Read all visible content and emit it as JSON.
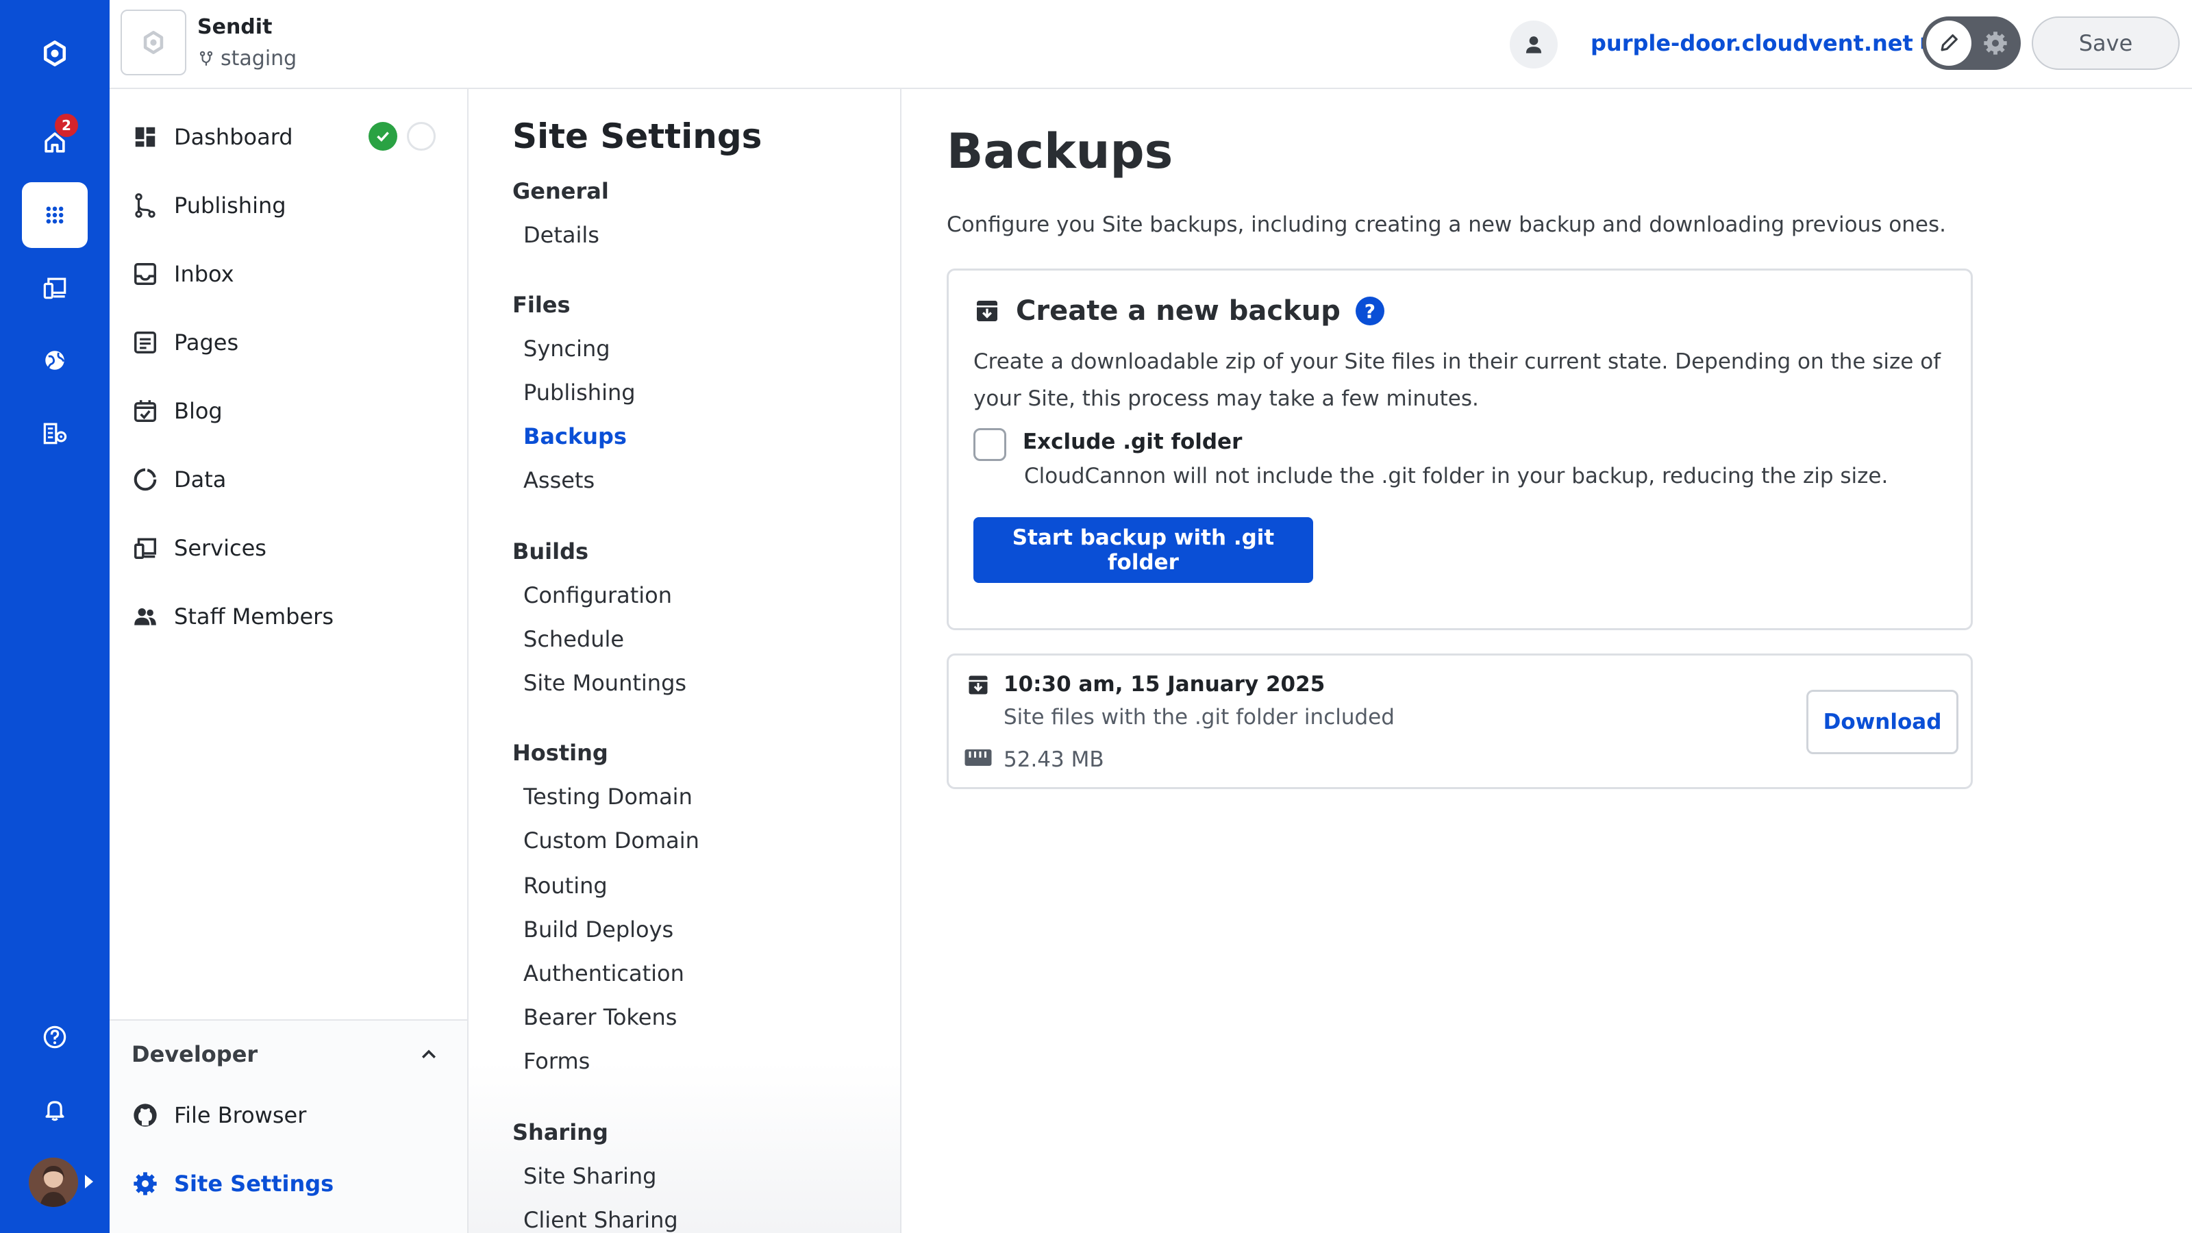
{
  "site": {
    "name": "Sendit",
    "branch": "staging",
    "domain": "purple-door.cloudvent.net"
  },
  "toolbar": {
    "save_label": "Save"
  },
  "rail": {
    "home_badge": "2"
  },
  "nav": {
    "items": [
      {
        "label": "Dashboard",
        "icon": "dashboard-icon"
      },
      {
        "label": "Publishing",
        "icon": "branch-icon"
      },
      {
        "label": "Inbox",
        "icon": "inbox-icon"
      },
      {
        "label": "Pages",
        "icon": "pages-icon"
      },
      {
        "label": "Blog",
        "icon": "calendar-check-icon"
      },
      {
        "label": "Data",
        "icon": "data-icon"
      },
      {
        "label": "Services",
        "icon": "services-icon"
      },
      {
        "label": "Staff Members",
        "icon": "people-icon"
      }
    ],
    "developer": {
      "heading": "Developer",
      "items": [
        {
          "label": "File Browser",
          "icon": "github-icon"
        },
        {
          "label": "Site Settings",
          "icon": "gear-icon"
        }
      ]
    }
  },
  "settings_nav": {
    "title": "Site Settings",
    "groups": [
      {
        "label": "General",
        "items": [
          "Details"
        ]
      },
      {
        "label": "Files",
        "items": [
          "Syncing",
          "Publishing",
          "Backups",
          "Assets"
        ]
      },
      {
        "label": "Builds",
        "items": [
          "Configuration",
          "Schedule",
          "Site Mountings"
        ]
      },
      {
        "label": "Hosting",
        "items": [
          "Testing Domain",
          "Custom Domain",
          "Routing",
          "Build Deploys",
          "Authentication",
          "Bearer Tokens",
          "Forms"
        ]
      },
      {
        "label": "Sharing",
        "items": [
          "Site Sharing",
          "Client Sharing"
        ]
      }
    ],
    "active": "Backups"
  },
  "main": {
    "title": "Backups",
    "description": "Configure you Site backups, including creating a new backup and downloading previous ones.",
    "create": {
      "heading": "Create a new backup",
      "help": "?",
      "text": "Create a downloadable zip of your Site files in their current state. Depending on the size of your Site, this process may take a few minutes.",
      "checkbox_label": "Exclude .git folder",
      "checkbox_hint": "CloudCannon will not include the .git folder in your backup, reducing the zip size.",
      "checkbox_checked": false,
      "button_label": "Start backup with .git folder"
    },
    "backups": [
      {
        "time": "10:30 am, 15 January 2025",
        "description": "Site files with the .git folder included",
        "size": "52.43 MB",
        "download_label": "Download"
      }
    ]
  },
  "colors": {
    "brand": "#0a4fd6",
    "success": "#2aa243",
    "badge": "#d3242c"
  }
}
